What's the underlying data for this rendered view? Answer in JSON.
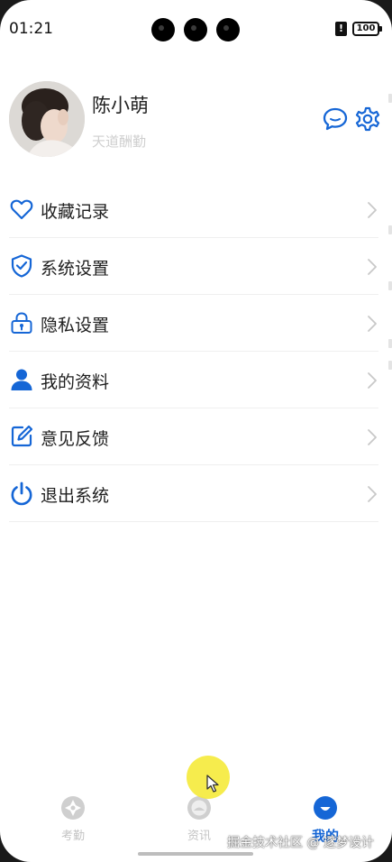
{
  "status_bar": {
    "time": "01:21",
    "battery": "100",
    "notification": "!"
  },
  "profile": {
    "name": "陈小萌",
    "signature": "天道酬勤"
  },
  "menu": [
    {
      "label": "收藏记录",
      "icon": "heart-icon"
    },
    {
      "label": "系统设置",
      "icon": "shield-check-icon"
    },
    {
      "label": "隐私设置",
      "icon": "lock-icon"
    },
    {
      "label": "我的资料",
      "icon": "person-icon"
    },
    {
      "label": "意见反馈",
      "icon": "edit-icon"
    },
    {
      "label": "退出系统",
      "icon": "power-icon"
    }
  ],
  "tabs": [
    {
      "label": "考勤",
      "icon": "attendance-icon",
      "active": false
    },
    {
      "label": "资讯",
      "icon": "news-icon",
      "active": false
    },
    {
      "label": "我的",
      "icon": "profile-tab-icon",
      "active": true
    }
  ],
  "watermark": "掘金技术社区 @ 逐梦设计",
  "colors": {
    "accent": "#1566d6",
    "inactive": "#c4c4c4",
    "text": "#1e1e1e",
    "divider": "#efefef"
  }
}
